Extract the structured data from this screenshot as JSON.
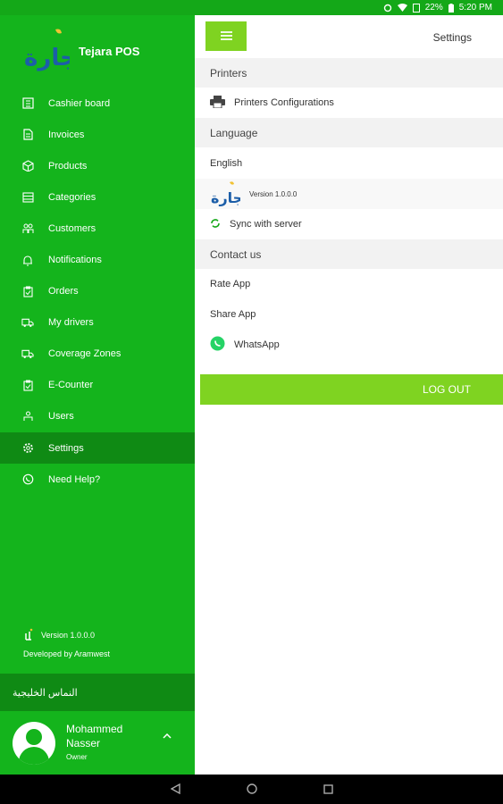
{
  "colors": {
    "drawer": "#14b41c",
    "drawer_active": "#0f8a14",
    "accent": "#7fd321"
  },
  "status_bar": {
    "battery": "22%",
    "time": "5:20 PM"
  },
  "drawer": {
    "app_name": "Tejara POS",
    "logo_text": "تجارة",
    "menu": [
      {
        "label": "Cashier board",
        "icon": "cashier-icon"
      },
      {
        "label": "Invoices",
        "icon": "invoice-icon"
      },
      {
        "label": "Products",
        "icon": "box-icon"
      },
      {
        "label": "Categories",
        "icon": "list-icon"
      },
      {
        "label": "Customers",
        "icon": "people-icon"
      },
      {
        "label": "Notifications",
        "icon": "bell-icon"
      },
      {
        "label": "Orders",
        "icon": "clipboard-icon"
      },
      {
        "label": "My drivers",
        "icon": "truck-icon"
      },
      {
        "label": "Coverage Zones",
        "icon": "truck-icon"
      },
      {
        "label": "E-Counter",
        "icon": "clipboard-icon"
      },
      {
        "label": "Users",
        "icon": "users-icon"
      },
      {
        "label": "Settings",
        "icon": "gear-icon"
      },
      {
        "label": "Need Help?",
        "icon": "whatsapp-icon"
      }
    ],
    "version": "Version 1.0.0.0",
    "developer": "Developed by Aramwest",
    "company": "النماس الخليجية",
    "user": {
      "first": "Mohammed",
      "last": "Nasser",
      "role": "Owner"
    }
  },
  "main": {
    "title": "Settings",
    "sections": {
      "printers": "Printers",
      "printers_config": "Printers Configurations",
      "language": "Language",
      "language_value": "English",
      "version": "Version 1.0.0.0",
      "sync": "Sync with server",
      "contact": "Contact us",
      "rate": "Rate App",
      "share": "Share App",
      "whatsapp": "WhatsApp"
    },
    "logout": "LOG OUT"
  }
}
